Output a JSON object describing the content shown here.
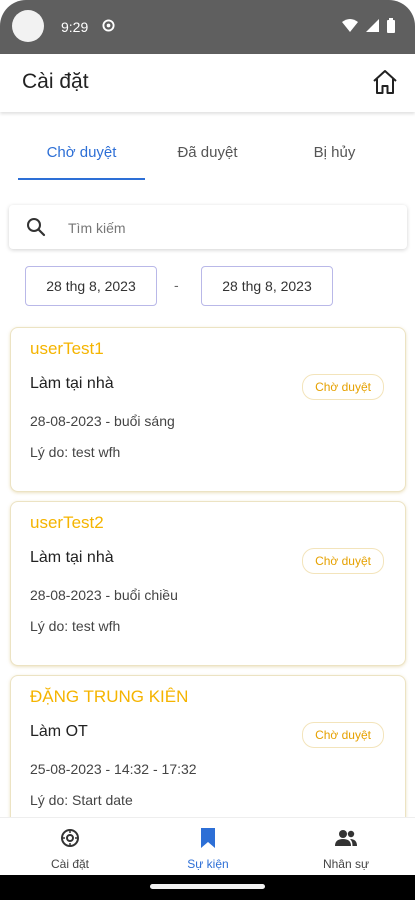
{
  "status_bar": {
    "time": "9:29"
  },
  "app_bar": {
    "title": "Cài đặt"
  },
  "tabs": [
    {
      "label": "Chờ duyệt",
      "active": true
    },
    {
      "label": "Đã duyệt",
      "active": false
    },
    {
      "label": "Bị hủy",
      "active": false
    }
  ],
  "search": {
    "placeholder": "Tìm kiếm",
    "value": ""
  },
  "date_range": {
    "from": "28 thg 8, 2023",
    "separator": "-",
    "to": "28 thg 8, 2023"
  },
  "requests": [
    {
      "name": "userTest1",
      "type": "Làm tại nhà",
      "status": "Chờ duyệt",
      "date": "28-08-2023 - buổi sáng",
      "reason": "Lý do: test wfh"
    },
    {
      "name": "userTest2",
      "type": "Làm tại nhà",
      "status": "Chờ duyệt",
      "date": "28-08-2023 - buổi chiều",
      "reason": "Lý do: test wfh"
    },
    {
      "name": "ĐẶNG TRUNG KIÊN",
      "type": "Làm OT",
      "status": "Chờ duyệt",
      "date": "25-08-2023 - 14:32 - 17:32",
      "reason": "Lý do: Start date"
    }
  ],
  "bottom_nav": [
    {
      "label": "Cài đặt",
      "icon": "settings-icon",
      "active": false
    },
    {
      "label": "Sự kiện",
      "icon": "bookmark-icon",
      "active": true
    },
    {
      "label": "Nhân sự",
      "icon": "people-icon",
      "active": false
    }
  ],
  "colors": {
    "accent": "#2d6fd6",
    "name": "#f5b400",
    "status": "#e6a100"
  }
}
